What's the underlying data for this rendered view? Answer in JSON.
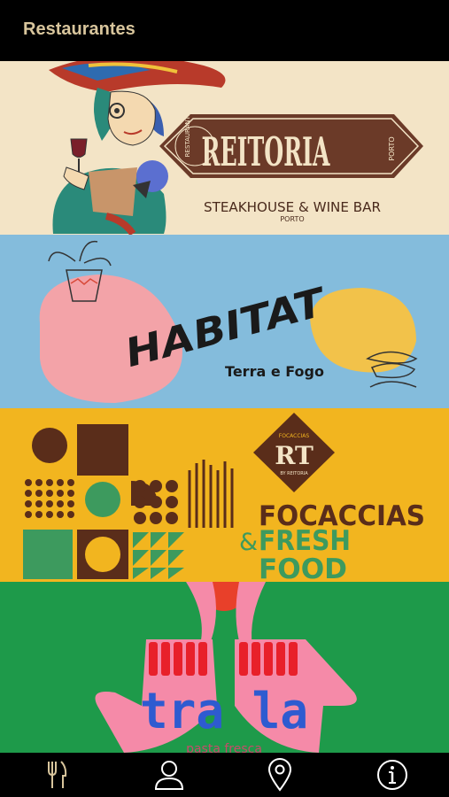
{
  "header": {
    "title": "Restaurantes"
  },
  "restaurants": [
    {
      "name": "REITORIA",
      "badge_left": "RESTAURANTE",
      "badge_right": "PORTO",
      "subtitle": "STEAKHOUSE & WINE BAR",
      "location": "PORTO",
      "bg_color": "#f3e4c6",
      "accent_color": "#6b3a28"
    },
    {
      "name": "HABITAT",
      "subtitle": "Terra e Fogo",
      "bg_color": "#84bcdc"
    },
    {
      "name": "RT",
      "badge_top": "FOCACCIAS",
      "badge_bottom": "BY REITORIA",
      "title_line1": "FOCACCIAS",
      "title_amp": "&",
      "title_line2": "FRESH",
      "title_line3": "FOOD",
      "bg_color": "#f2b51f",
      "accent_color": "#5a2d1a",
      "green_color": "#3d9a5e"
    },
    {
      "name": "tra la",
      "subtitle": "pasta fresca",
      "bg_color": "#1e9a4a"
    }
  ],
  "tabbar": {
    "tabs": [
      {
        "icon": "fork-knife-icon",
        "active": true,
        "color": "#d8c59c"
      },
      {
        "icon": "user-icon",
        "active": false,
        "color": "#ffffff"
      },
      {
        "icon": "map-pin-icon",
        "active": false,
        "color": "#ffffff"
      },
      {
        "icon": "info-icon",
        "active": false,
        "color": "#ffffff"
      }
    ]
  }
}
